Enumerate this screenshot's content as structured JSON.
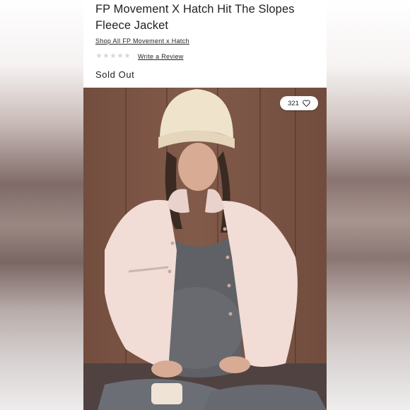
{
  "product": {
    "title": "FP Movement X Hatch Hit The Slopes Fleece Jacket",
    "shop_link": "Shop All FP Movement x Hatch",
    "rating": {
      "stars_filled": 0,
      "stars_total": 5
    },
    "review_link": "Write a Review",
    "availability": "Sold Out"
  },
  "image": {
    "like_count": "321",
    "like_icon": "heart-outline-icon"
  },
  "colors": {
    "text": "#222222",
    "star_empty": "#d6d6d6",
    "panel_bg": "#ffffff"
  }
}
